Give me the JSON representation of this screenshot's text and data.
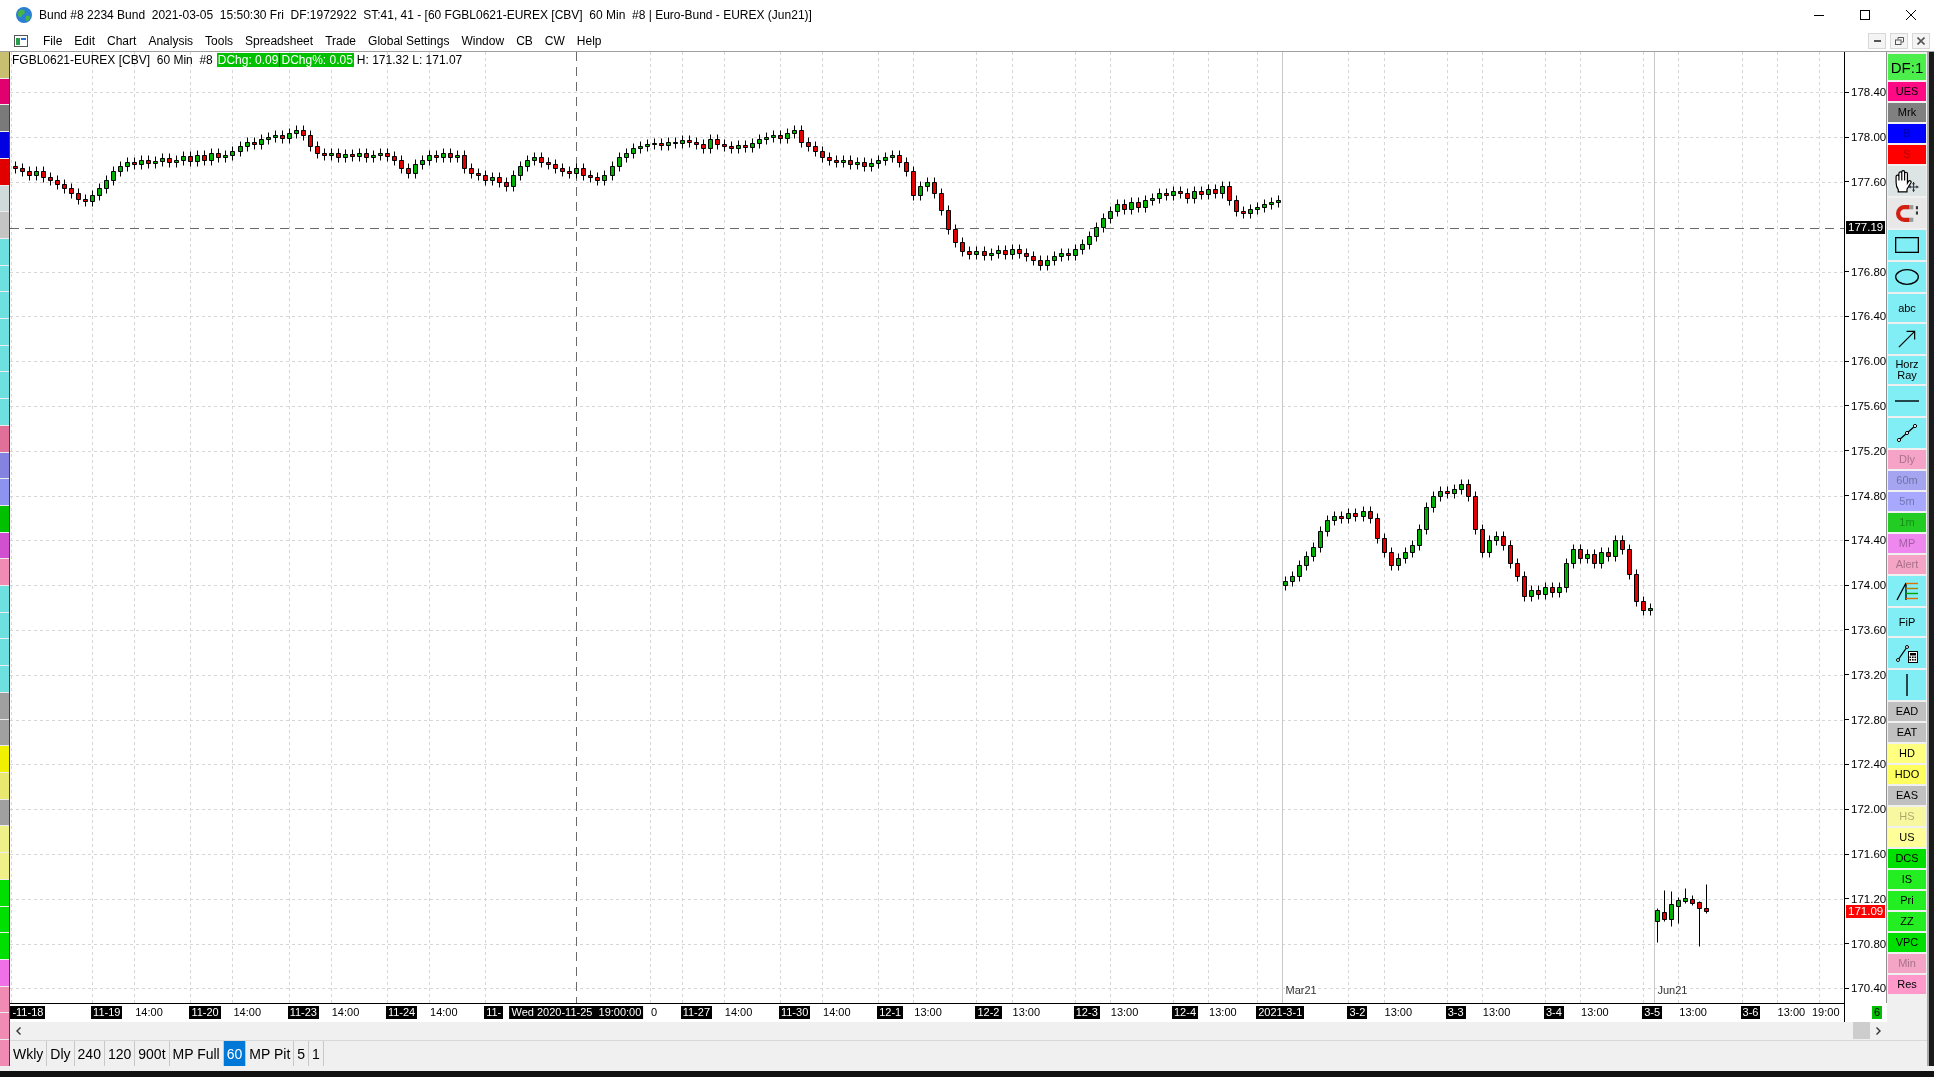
{
  "window": {
    "title": "Bund #8 2234 Bund  2021-03-05  15:50:30 Fri  DF:1972922  ST:41, 41 - [60 FGBL0621-EUREX [CBV]  60 Min  #8 | Euro-Bund - EUREX (Jun21)]"
  },
  "menu": [
    "File",
    "Edit",
    "Chart",
    "Analysis",
    "Tools",
    "Spreadsheet",
    "Trade",
    "Global Settings",
    "Window",
    "CB",
    "CW",
    "Help"
  ],
  "left_strip": [
    {
      "color": "#c8c070"
    },
    {
      "color": "#e0006e"
    },
    {
      "color": "#7a7a7a"
    },
    {
      "color": "#0000e0"
    },
    {
      "color": "#e00000"
    },
    {
      "color": "#d0dada"
    },
    {
      "color": "#c4c4c4"
    },
    {
      "color": "#6ee0e0"
    },
    {
      "color": "#6ee0e0"
    },
    {
      "color": "#6ee0e0"
    },
    {
      "color": "#6ee0e0"
    },
    {
      "color": "#6ee0e0"
    },
    {
      "color": "#6ee0e0"
    },
    {
      "color": "#6ee0e0"
    },
    {
      "color": "#e07098"
    },
    {
      "color": "#8484e0"
    },
    {
      "color": "#8c94f0"
    },
    {
      "color": "#00c000"
    },
    {
      "color": "#d050d0"
    },
    {
      "color": "#f08cb4"
    },
    {
      "color": "#6ee0e0"
    },
    {
      "color": "#6ee0e0"
    },
    {
      "color": "#6ee0e0"
    },
    {
      "color": "#6ee0e0"
    },
    {
      "color": "#a0a0a0"
    },
    {
      "color": "#a0a0a0"
    },
    {
      "color": "#f0f000"
    },
    {
      "color": "#e8e870"
    },
    {
      "color": "#a0a0a0"
    },
    {
      "color": "#f0f088"
    },
    {
      "color": "#f0f088"
    },
    {
      "color": "#00e000"
    },
    {
      "color": "#00e000"
    },
    {
      "color": "#00e000"
    },
    {
      "color": "#f070e8"
    },
    {
      "color": "#f08cb4"
    },
    {
      "color": "#f08cb4"
    },
    {
      "color": "#f08cb4"
    }
  ],
  "chart": {
    "header": {
      "symbol": "FGBL0621-EUREX [CBV]  60 Min  #8",
      "changes": [
        "DChg: 0.09",
        "DChg%: 0.05"
      ],
      "range": "H: 171.32 L: 171.07"
    },
    "price_labels": [
      "178.40",
      "178.00",
      "177.60",
      "176.80",
      "176.40",
      "176.00",
      "175.60",
      "175.20",
      "174.80",
      "174.40",
      "174.00",
      "173.60",
      "173.20",
      "172.80",
      "172.40",
      "172.00",
      "171.60",
      "171.20",
      "170.80",
      "170.40"
    ],
    "price_markers": [
      {
        "label": "177.19",
        "kind": "cursor"
      },
      {
        "label": "171.09",
        "kind": "last"
      }
    ],
    "time_labels": [
      {
        "label": "-11-18",
        "kind": "date"
      },
      {
        "label": "11-19",
        "kind": "date"
      },
      {
        "label": "14:00",
        "kind": "time"
      },
      {
        "label": "11-20",
        "kind": "date"
      },
      {
        "label": "14:00",
        "kind": "time"
      },
      {
        "label": "11-23",
        "kind": "date"
      },
      {
        "label": "14:00",
        "kind": "time"
      },
      {
        "label": "11-24",
        "kind": "date"
      },
      {
        "label": "14:00",
        "kind": "time"
      },
      {
        "label": "11-",
        "kind": "date"
      },
      {
        "label": "0",
        "kind": "time"
      },
      {
        "label": "11-27",
        "kind": "date"
      },
      {
        "label": "14:00",
        "kind": "time"
      },
      {
        "label": "11-30",
        "kind": "date"
      },
      {
        "label": "14:00",
        "kind": "time"
      },
      {
        "label": "12-1",
        "kind": "date"
      },
      {
        "label": "13:00",
        "kind": "time"
      },
      {
        "label": "12-2",
        "kind": "date"
      },
      {
        "label": "13:00",
        "kind": "time"
      },
      {
        "label": "12-3",
        "kind": "date"
      },
      {
        "label": "13:00",
        "kind": "time"
      },
      {
        "label": "12-4",
        "kind": "date"
      },
      {
        "label": "13:00",
        "kind": "time"
      },
      {
        "label": "2021-3-1",
        "kind": "date"
      },
      {
        "label": "3-2",
        "kind": "date"
      },
      {
        "label": "13:00",
        "kind": "time"
      },
      {
        "label": "3-3",
        "kind": "date"
      },
      {
        "label": "13:00",
        "kind": "time"
      },
      {
        "label": "3-4",
        "kind": "date"
      },
      {
        "label": "13:00",
        "kind": "time"
      },
      {
        "label": "3-5",
        "kind": "date"
      },
      {
        "label": "13:00",
        "kind": "time"
      },
      {
        "label": "3-6",
        "kind": "date"
      },
      {
        "label": "13:00",
        "kind": "time"
      },
      {
        "label": "19:00",
        "kind": "time"
      }
    ],
    "cursor_time": "Wed 2020-11-25  19:00:00",
    "contract_labels": [
      "Mar21",
      "Jun21"
    ],
    "corner_badge": "6"
  },
  "toolbar": [
    {
      "kind": "status",
      "label": "DF:1",
      "color": "#4cee4c",
      "disabled": false
    },
    {
      "kind": "text",
      "label": "UES",
      "color": "#ff0a84",
      "disabled": false
    },
    {
      "kind": "text",
      "label": "Mrk",
      "color": "#808080",
      "disabled": false
    },
    {
      "kind": "text",
      "label": "B",
      "color": "#0000ff",
      "disabled": true
    },
    {
      "kind": "text",
      "label": "S",
      "color": "#ff0000",
      "disabled": true
    },
    {
      "kind": "hand",
      "color": "#dce4e4",
      "disabled": false
    },
    {
      "kind": "magnet",
      "color": "#e8e8e8",
      "disabled": false
    },
    {
      "kind": "rectangle",
      "color": "#80eef4",
      "disabled": false
    },
    {
      "kind": "ellipse",
      "color": "#80eef4",
      "disabled": false
    },
    {
      "kind": "tool",
      "label": "abc",
      "color": "#80eef4",
      "disabled": false
    },
    {
      "kind": "arrow",
      "color": "#80eef4",
      "disabled": false
    },
    {
      "kind": "tool",
      "label": "Horz Ray",
      "color": "#80eef4",
      "disabled": false
    },
    {
      "kind": "line",
      "color": "#80eef4",
      "disabled": false
    },
    {
      "kind": "segment",
      "color": "#80eef4",
      "disabled": false
    },
    {
      "kind": "text",
      "label": "Dly",
      "color": "#f5a3c7",
      "disabled": true
    },
    {
      "kind": "text",
      "label": "60m",
      "color": "#a4a4f0",
      "disabled": true
    },
    {
      "kind": "text",
      "label": "5m",
      "color": "#a8a8ff",
      "disabled": true
    },
    {
      "kind": "text",
      "label": "1m",
      "color": "#22cc22",
      "disabled": true
    },
    {
      "kind": "text",
      "label": "MP",
      "color": "#ee88ee",
      "disabled": true
    },
    {
      "kind": "text",
      "label": "Alert",
      "color": "#f4a4c4",
      "disabled": true
    },
    {
      "kind": "fan",
      "color": "#80eef4",
      "disabled": false
    },
    {
      "kind": "tool",
      "label": "FiP",
      "color": "#80eef4",
      "disabled": false
    },
    {
      "kind": "calculator",
      "color": "#80eef4",
      "disabled": false
    },
    {
      "kind": "vline",
      "color": "#80eef4",
      "disabled": false
    },
    {
      "kind": "text",
      "label": "EAD",
      "color": "#c0c0c0",
      "disabled": false
    },
    {
      "kind": "text",
      "label": "EAT",
      "color": "#c0c0c0",
      "disabled": false
    },
    {
      "kind": "text",
      "label": "HD",
      "color": "#ffff80",
      "disabled": false
    },
    {
      "kind": "text",
      "label": "HDO",
      "color": "#ffff60",
      "disabled": false
    },
    {
      "kind": "text",
      "label": "EAS",
      "color": "#c0c0c0",
      "disabled": false
    },
    {
      "kind": "text",
      "label": "HS",
      "color": "#f8f8a0",
      "disabled": true
    },
    {
      "kind": "text",
      "label": "US",
      "color": "#ffff99",
      "disabled": false
    },
    {
      "kind": "text",
      "label": "DCS",
      "color": "#00e000",
      "disabled": false
    },
    {
      "kind": "text",
      "label": "IS",
      "color": "#22ee22",
      "disabled": false
    },
    {
      "kind": "text",
      "label": "Pri",
      "color": "#22ee22",
      "disabled": false
    },
    {
      "kind": "text",
      "label": "ZZ",
      "color": "#22ee22",
      "disabled": false
    },
    {
      "kind": "text",
      "label": "VPC",
      "color": "#00e000",
      "disabled": false
    },
    {
      "kind": "text",
      "label": "Min",
      "color": "#f4a4c4",
      "disabled": true
    },
    {
      "kind": "text",
      "label": "Res",
      "color": "#ff99cc",
      "disabled": false
    }
  ],
  "tabs": [
    {
      "label": "Wkly",
      "selected": false
    },
    {
      "label": "Dly",
      "selected": false
    },
    {
      "label": "240",
      "selected": false
    },
    {
      "label": "120",
      "selected": false
    },
    {
      "label": "900t",
      "selected": false
    },
    {
      "label": "MP Full",
      "selected": false
    },
    {
      "label": "60",
      "selected": true
    },
    {
      "label": "MP Pit",
      "selected": false
    },
    {
      "label": "5",
      "selected": false
    },
    {
      "label": "1",
      "selected": false
    }
  ]
}
